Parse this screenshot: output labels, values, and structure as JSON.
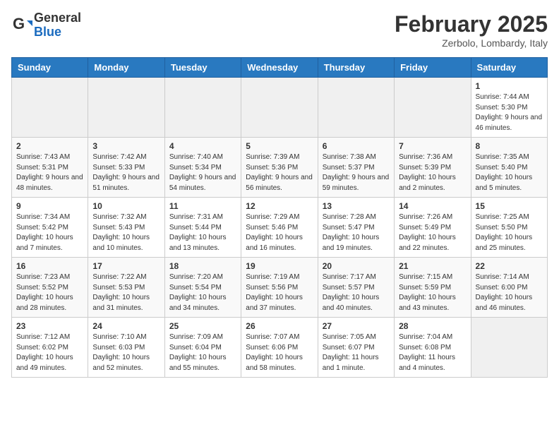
{
  "logo": {
    "general": "General",
    "blue": "Blue"
  },
  "header": {
    "month_year": "February 2025",
    "location": "Zerbolo, Lombardy, Italy"
  },
  "weekdays": [
    "Sunday",
    "Monday",
    "Tuesday",
    "Wednesday",
    "Thursday",
    "Friday",
    "Saturday"
  ],
  "weeks": [
    [
      {
        "day": "",
        "info": ""
      },
      {
        "day": "",
        "info": ""
      },
      {
        "day": "",
        "info": ""
      },
      {
        "day": "",
        "info": ""
      },
      {
        "day": "",
        "info": ""
      },
      {
        "day": "",
        "info": ""
      },
      {
        "day": "1",
        "info": "Sunrise: 7:44 AM\nSunset: 5:30 PM\nDaylight: 9 hours and 46 minutes."
      }
    ],
    [
      {
        "day": "2",
        "info": "Sunrise: 7:43 AM\nSunset: 5:31 PM\nDaylight: 9 hours and 48 minutes."
      },
      {
        "day": "3",
        "info": "Sunrise: 7:42 AM\nSunset: 5:33 PM\nDaylight: 9 hours and 51 minutes."
      },
      {
        "day": "4",
        "info": "Sunrise: 7:40 AM\nSunset: 5:34 PM\nDaylight: 9 hours and 54 minutes."
      },
      {
        "day": "5",
        "info": "Sunrise: 7:39 AM\nSunset: 5:36 PM\nDaylight: 9 hours and 56 minutes."
      },
      {
        "day": "6",
        "info": "Sunrise: 7:38 AM\nSunset: 5:37 PM\nDaylight: 9 hours and 59 minutes."
      },
      {
        "day": "7",
        "info": "Sunrise: 7:36 AM\nSunset: 5:39 PM\nDaylight: 10 hours and 2 minutes."
      },
      {
        "day": "8",
        "info": "Sunrise: 7:35 AM\nSunset: 5:40 PM\nDaylight: 10 hours and 5 minutes."
      }
    ],
    [
      {
        "day": "9",
        "info": "Sunrise: 7:34 AM\nSunset: 5:42 PM\nDaylight: 10 hours and 7 minutes."
      },
      {
        "day": "10",
        "info": "Sunrise: 7:32 AM\nSunset: 5:43 PM\nDaylight: 10 hours and 10 minutes."
      },
      {
        "day": "11",
        "info": "Sunrise: 7:31 AM\nSunset: 5:44 PM\nDaylight: 10 hours and 13 minutes."
      },
      {
        "day": "12",
        "info": "Sunrise: 7:29 AM\nSunset: 5:46 PM\nDaylight: 10 hours and 16 minutes."
      },
      {
        "day": "13",
        "info": "Sunrise: 7:28 AM\nSunset: 5:47 PM\nDaylight: 10 hours and 19 minutes."
      },
      {
        "day": "14",
        "info": "Sunrise: 7:26 AM\nSunset: 5:49 PM\nDaylight: 10 hours and 22 minutes."
      },
      {
        "day": "15",
        "info": "Sunrise: 7:25 AM\nSunset: 5:50 PM\nDaylight: 10 hours and 25 minutes."
      }
    ],
    [
      {
        "day": "16",
        "info": "Sunrise: 7:23 AM\nSunset: 5:52 PM\nDaylight: 10 hours and 28 minutes."
      },
      {
        "day": "17",
        "info": "Sunrise: 7:22 AM\nSunset: 5:53 PM\nDaylight: 10 hours and 31 minutes."
      },
      {
        "day": "18",
        "info": "Sunrise: 7:20 AM\nSunset: 5:54 PM\nDaylight: 10 hours and 34 minutes."
      },
      {
        "day": "19",
        "info": "Sunrise: 7:19 AM\nSunset: 5:56 PM\nDaylight: 10 hours and 37 minutes."
      },
      {
        "day": "20",
        "info": "Sunrise: 7:17 AM\nSunset: 5:57 PM\nDaylight: 10 hours and 40 minutes."
      },
      {
        "day": "21",
        "info": "Sunrise: 7:15 AM\nSunset: 5:59 PM\nDaylight: 10 hours and 43 minutes."
      },
      {
        "day": "22",
        "info": "Sunrise: 7:14 AM\nSunset: 6:00 PM\nDaylight: 10 hours and 46 minutes."
      }
    ],
    [
      {
        "day": "23",
        "info": "Sunrise: 7:12 AM\nSunset: 6:02 PM\nDaylight: 10 hours and 49 minutes."
      },
      {
        "day": "24",
        "info": "Sunrise: 7:10 AM\nSunset: 6:03 PM\nDaylight: 10 hours and 52 minutes."
      },
      {
        "day": "25",
        "info": "Sunrise: 7:09 AM\nSunset: 6:04 PM\nDaylight: 10 hours and 55 minutes."
      },
      {
        "day": "26",
        "info": "Sunrise: 7:07 AM\nSunset: 6:06 PM\nDaylight: 10 hours and 58 minutes."
      },
      {
        "day": "27",
        "info": "Sunrise: 7:05 AM\nSunset: 6:07 PM\nDaylight: 11 hours and 1 minute."
      },
      {
        "day": "28",
        "info": "Sunrise: 7:04 AM\nSunset: 6:08 PM\nDaylight: 11 hours and 4 minutes."
      },
      {
        "day": "",
        "info": ""
      }
    ]
  ]
}
